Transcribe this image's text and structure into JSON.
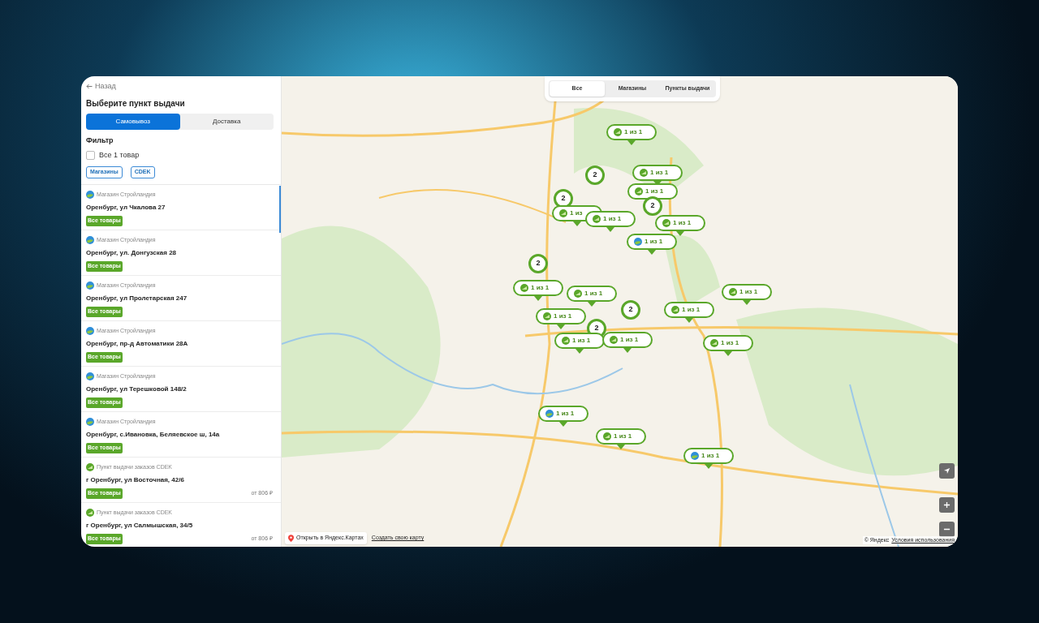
{
  "back": {
    "label": "Назад"
  },
  "title": "Выберите пункт выдачи",
  "mode_tabs": [
    {
      "label": "Самовывоз",
      "selected": true
    },
    {
      "label": "Доставка",
      "selected": false
    }
  ],
  "filter": {
    "title": "Фильтр",
    "checkbox": {
      "label": "Все 1 товар",
      "checked": false
    },
    "chips": [
      "Магазины",
      "CDEK"
    ]
  },
  "points": [
    {
      "kind": "store",
      "provider": "Магазин Стройландия",
      "address": "Оренбург, ул Чкалова 27",
      "badge": "Все товары"
    },
    {
      "kind": "store",
      "provider": "Магазин Стройландия",
      "address": "Оренбург, ул. Донгузская 28",
      "badge": "Все товары"
    },
    {
      "kind": "store",
      "provider": "Магазин Стройландия",
      "address": "Оренбург, ул Пролетарская 247",
      "badge": "Все товары"
    },
    {
      "kind": "store",
      "provider": "Магазин Стройландия",
      "address": "Оренбург, пр-д Автоматики 28А",
      "badge": "Все товары"
    },
    {
      "kind": "store",
      "provider": "Магазин Стройландия",
      "address": "Оренбург, ул Терешковой 148/2",
      "badge": "Все товары"
    },
    {
      "kind": "store",
      "provider": "Магазин Стройландия",
      "address": "Оренбург, с.Ивановка, Беляевское ш, 14а",
      "badge": "Все товары"
    },
    {
      "kind": "cdek",
      "provider": "Пункт выдачи заказов CDEK",
      "address": "г Оренбург, ул Восточная, 42/6",
      "badge": "Все товары",
      "price": "от 806 ₽"
    },
    {
      "kind": "cdek",
      "provider": "Пункт выдачи заказов CDEK",
      "address": "г Оренбург, ул Салмышская, 34/5",
      "badge": "Все товары",
      "price": "от 806 ₽"
    }
  ],
  "map_tabs": [
    {
      "label": "Все",
      "selected": true
    },
    {
      "label": "Магазины",
      "selected": false
    },
    {
      "label": "Пункты выдачи",
      "selected": false
    }
  ],
  "markers": [
    {
      "kind": "cdek",
      "label": "1 из 1"
    },
    {
      "kind": "cluster",
      "label": "2"
    },
    {
      "kind": "cdek",
      "label": "1 из 1"
    },
    {
      "kind": "cdek",
      "label": "1 из 1"
    },
    {
      "kind": "cluster",
      "label": "2"
    },
    {
      "kind": "cluster",
      "label": "2"
    },
    {
      "kind": "cdek",
      "label": "1 из"
    },
    {
      "kind": "cdek",
      "label": "1 из 1"
    },
    {
      "kind": "cdek",
      "label": "1 из 1"
    },
    {
      "kind": "store",
      "label": "1 из 1"
    },
    {
      "kind": "cluster",
      "label": "2"
    },
    {
      "kind": "cdek",
      "label": "1 из 1"
    },
    {
      "kind": "cdek",
      "label": "1 из 1"
    },
    {
      "kind": "cdek",
      "label": "1 из 1"
    },
    {
      "kind": "cluster",
      "label": "2"
    },
    {
      "kind": "cdek",
      "label": "1 из 1"
    },
    {
      "kind": "cdek",
      "label": "1 из 1"
    },
    {
      "kind": "cluster",
      "label": "2"
    },
    {
      "kind": "cdek",
      "label": "1 из 1"
    },
    {
      "kind": "cdek",
      "label": "1 из 1"
    },
    {
      "kind": "cdek",
      "label": "1 из 1"
    },
    {
      "kind": "store",
      "label": "1 из 1"
    },
    {
      "kind": "cdek",
      "label": "1 из 1"
    },
    {
      "kind": "store",
      "label": "1 из 1"
    }
  ],
  "map_footer": {
    "open_link": "Открыть в Яндекс.Картах",
    "create_link": "Создать свою карту",
    "copyright": "© Яндекс",
    "terms_link": "Условия использования"
  }
}
